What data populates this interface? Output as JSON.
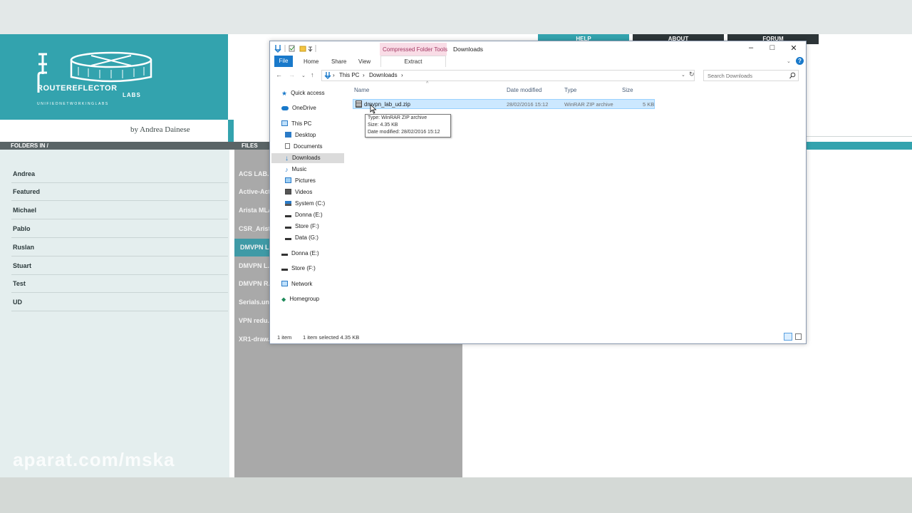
{
  "website": {
    "logo": {
      "line1": "ROUTEREFLECTOR",
      "line2": "LABS",
      "tagline": "UNIFIEDNETWORKINGLABS"
    },
    "author": "by Andrea Dainese",
    "nav": [
      "HELP",
      "ABOUT",
      "FORUM"
    ],
    "folders_header": "FOLDERS IN /",
    "files_header": "FILES",
    "folders": [
      "Andrea",
      "Featured",
      "Michael",
      "Pablo",
      "Ruslan",
      "Stuart",
      "Test",
      "UD"
    ],
    "files": [
      "ACS LAB...",
      "Active-Act...",
      "Arista MLA...",
      "CSR_Arist...",
      "DMVPN L...",
      "DMVPN L...",
      "DMVPN R...",
      "Serials.un...",
      "VPN redu...",
      "XR1-draw..."
    ],
    "watermark": "aparat.com/mska"
  },
  "explorer": {
    "context_tab": "Compressed Folder Tools",
    "title": "Downloads",
    "ribbon": {
      "file": "File",
      "home": "Home",
      "share": "Share",
      "view": "View",
      "extract": "Extract"
    },
    "breadcrumb": [
      "This PC",
      "Downloads"
    ],
    "search_placeholder": "Search Downloads",
    "nav": {
      "quick_access": "Quick access",
      "onedrive": "OneDrive",
      "this_pc": "This PC",
      "desktop": "Desktop",
      "documents": "Documents",
      "downloads": "Downloads",
      "music": "Music",
      "pictures": "Pictures",
      "videos": "Videos",
      "system_c": "System (C:)",
      "donna_e": "Donna (E:)",
      "store_f": "Store (F:)",
      "data_g": "Data (G:)",
      "donna_e2": "Donna (E:)",
      "store_f2": "Store (F:)",
      "network": "Network",
      "homegroup": "Homegroup"
    },
    "columns": {
      "name": "Name",
      "date": "Date modified",
      "type": "Type",
      "size": "Size"
    },
    "file": {
      "name": "dmvpn_lab_ud.zip",
      "date": "28/02/2016 15:12",
      "type": "WinRAR ZIP archive",
      "size": "5 KB"
    },
    "tooltip": {
      "type": "Type: WinRAR ZIP archive",
      "size": "Size: 4.35 KB",
      "date": "Date modified: 28/02/2016 15:12"
    },
    "status": {
      "count": "1 item",
      "selected": "1 item selected  4.35 KB"
    }
  },
  "icons": [
    "file-explorer-icon",
    "properties-icon",
    "new-folder-icon",
    "pin-icon",
    "back-arrow-icon",
    "forward-arrow-icon",
    "up-arrow-icon",
    "refresh-icon",
    "search-icon",
    "help-icon",
    "zip-icon",
    "mouse-cursor-icon"
  ],
  "colors": {
    "brand_teal": "#33a3ae",
    "accent_blue": "#1979ca",
    "selection": "#cce8ff",
    "context_pink": "#f9dce6"
  }
}
